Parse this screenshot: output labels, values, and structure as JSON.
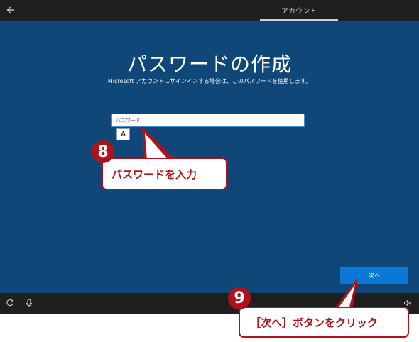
{
  "topbar": {
    "back_icon": "back-arrow-icon",
    "tab_label": "アカウント"
  },
  "main": {
    "title": "パスワードの作成",
    "subtitle": "Microsoft アカウントにサインインする場合は、このパスワードを使用します。",
    "password_placeholder": "パスワード",
    "password_value": "",
    "ime_mode": "A",
    "next_label": "次へ"
  },
  "bottombar": {
    "icons": [
      "ease-of-access-icon",
      "microphone-icon",
      "volume-icon"
    ]
  },
  "annotations": {
    "step8_number": "8",
    "step8_text": "パスワードを入力",
    "step9_number": "9",
    "step9_text": "［次へ］ボタンをクリック"
  },
  "colors": {
    "background_blue": "#0f4779",
    "bar_dark": "#1f1f1f",
    "accent_button": "#0a78d4",
    "annotation_red": "#b0121b"
  }
}
